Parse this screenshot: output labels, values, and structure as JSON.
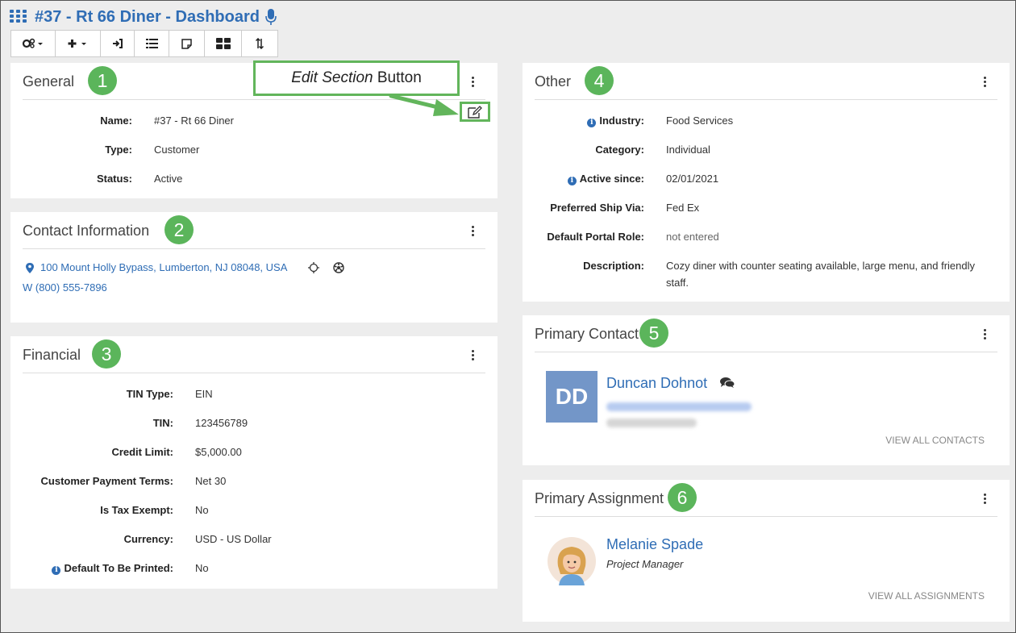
{
  "header": {
    "title": "#37 - Rt 66 Diner - Dashboard",
    "toolbar": [
      {
        "name": "settings",
        "glyph": "⚙▾"
      },
      {
        "name": "add",
        "glyph": "+▾"
      },
      {
        "name": "sign-in",
        "glyph": "→"
      },
      {
        "name": "list",
        "glyph": "≡"
      },
      {
        "name": "note",
        "glyph": "▢"
      },
      {
        "name": "tiles",
        "glyph": "▦"
      },
      {
        "name": "sort",
        "glyph": "⇅"
      }
    ]
  },
  "callout": {
    "italic": "Edit Section",
    "rest": "Button"
  },
  "general": {
    "title": "General",
    "badge": "1",
    "fields": [
      {
        "label": "Name:",
        "value": "#37 - Rt 66 Diner"
      },
      {
        "label": "Type:",
        "value": "Customer"
      },
      {
        "label": "Status:",
        "value": "Active"
      }
    ]
  },
  "contact": {
    "title": "Contact Information",
    "badge": "2",
    "address": "100 Mount Holly Bypass, Lumberton, NJ 08048, USA",
    "phone": "W (800) 555-7896"
  },
  "financial": {
    "title": "Financial",
    "badge": "3",
    "fields": [
      {
        "label": "TIN Type:",
        "value": "EIN"
      },
      {
        "label": "TIN:",
        "value": "123456789"
      },
      {
        "label": "Credit Limit:",
        "value": "$5,000.00"
      },
      {
        "label": "Customer Payment Terms:",
        "value": "Net 30"
      },
      {
        "label": "Is Tax Exempt:",
        "value": "No"
      },
      {
        "label": "Currency:",
        "value": "USD - US Dollar"
      },
      {
        "label": "Default To Be Printed:",
        "value": "No"
      }
    ]
  },
  "other": {
    "title": "Other",
    "badge": "4",
    "fields": [
      {
        "label": "Industry:",
        "value": "Food Services"
      },
      {
        "label": "Category:",
        "value": "Individual"
      },
      {
        "label": "Active since:",
        "value": "02/01/2021"
      },
      {
        "label": "Preferred Ship Via:",
        "value": "Fed Ex"
      },
      {
        "label": "Default Portal Role:",
        "value": "not entered"
      },
      {
        "label": "Description:",
        "value": "Cozy diner with counter seating available, large menu, and friendly",
        "value2": "staff."
      }
    ]
  },
  "primary_contact": {
    "title": "Primary Contact",
    "badge": "5",
    "initials": "DD",
    "name": "Duncan Dohnot",
    "view_all": "VIEW ALL CONTACTS"
  },
  "primary_assignment": {
    "title": "Primary Assignment",
    "badge": "6",
    "name": "Melanie Spade",
    "role": "Project Manager",
    "view_all": "VIEW ALL ASSIGNMENTS"
  },
  "colors": {
    "accent": "#2f6db5",
    "badge": "#5bb55b",
    "avatar": "#7396c8"
  }
}
